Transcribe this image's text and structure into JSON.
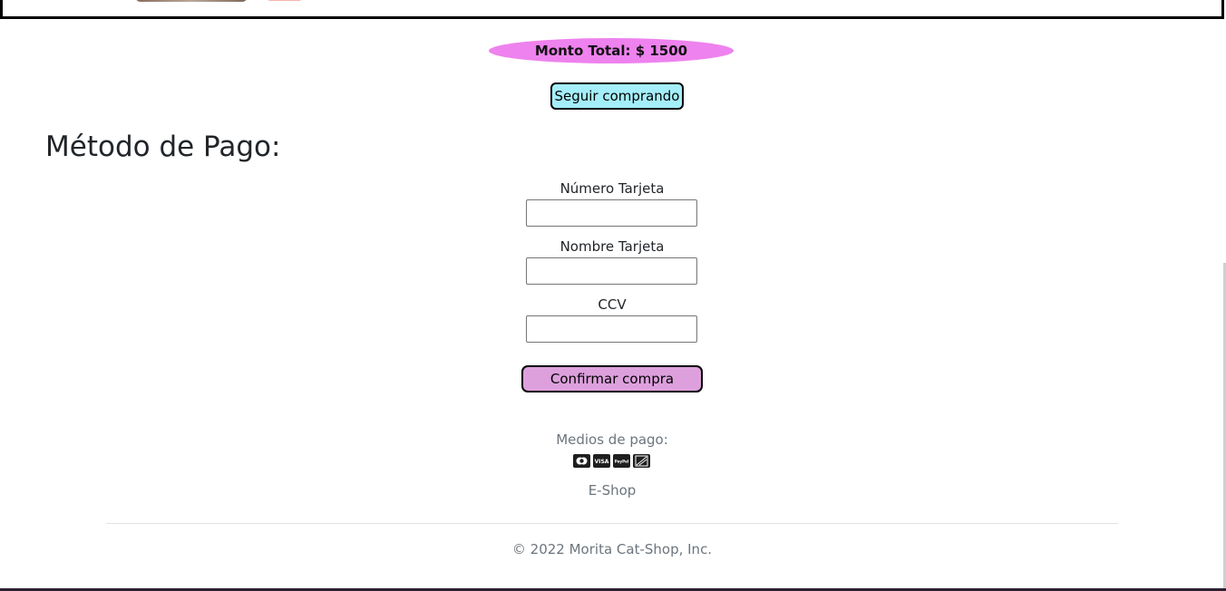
{
  "cart": {
    "total_label": "Monto Total: $ 1500",
    "continue_button": "Seguir comprando"
  },
  "payment": {
    "title": "Método de Pago:",
    "card_number_label": "Número Tarjeta",
    "card_name_label": "Nombre Tarjeta",
    "ccv_label": "CCV",
    "card_number_value": "",
    "card_name_value": "",
    "ccv_value": "",
    "confirm_button": "Confirmar compra"
  },
  "footer": {
    "payment_methods_label": "Medios de pago:",
    "payment_icons": [
      "mastercard-icon",
      "visa-icon",
      "paypal-icon",
      "amex-icon"
    ],
    "visa_text": "VISA",
    "paypal_text": "PayPal",
    "eshop_link": "E-Shop",
    "copyright": "© 2022 Morita Cat-Shop, Inc."
  },
  "colors": {
    "total_pill": "#ee82ee",
    "continue_button": "#a4eef9",
    "confirm_button": "#dda0dd",
    "muted_text": "#6c757d"
  }
}
